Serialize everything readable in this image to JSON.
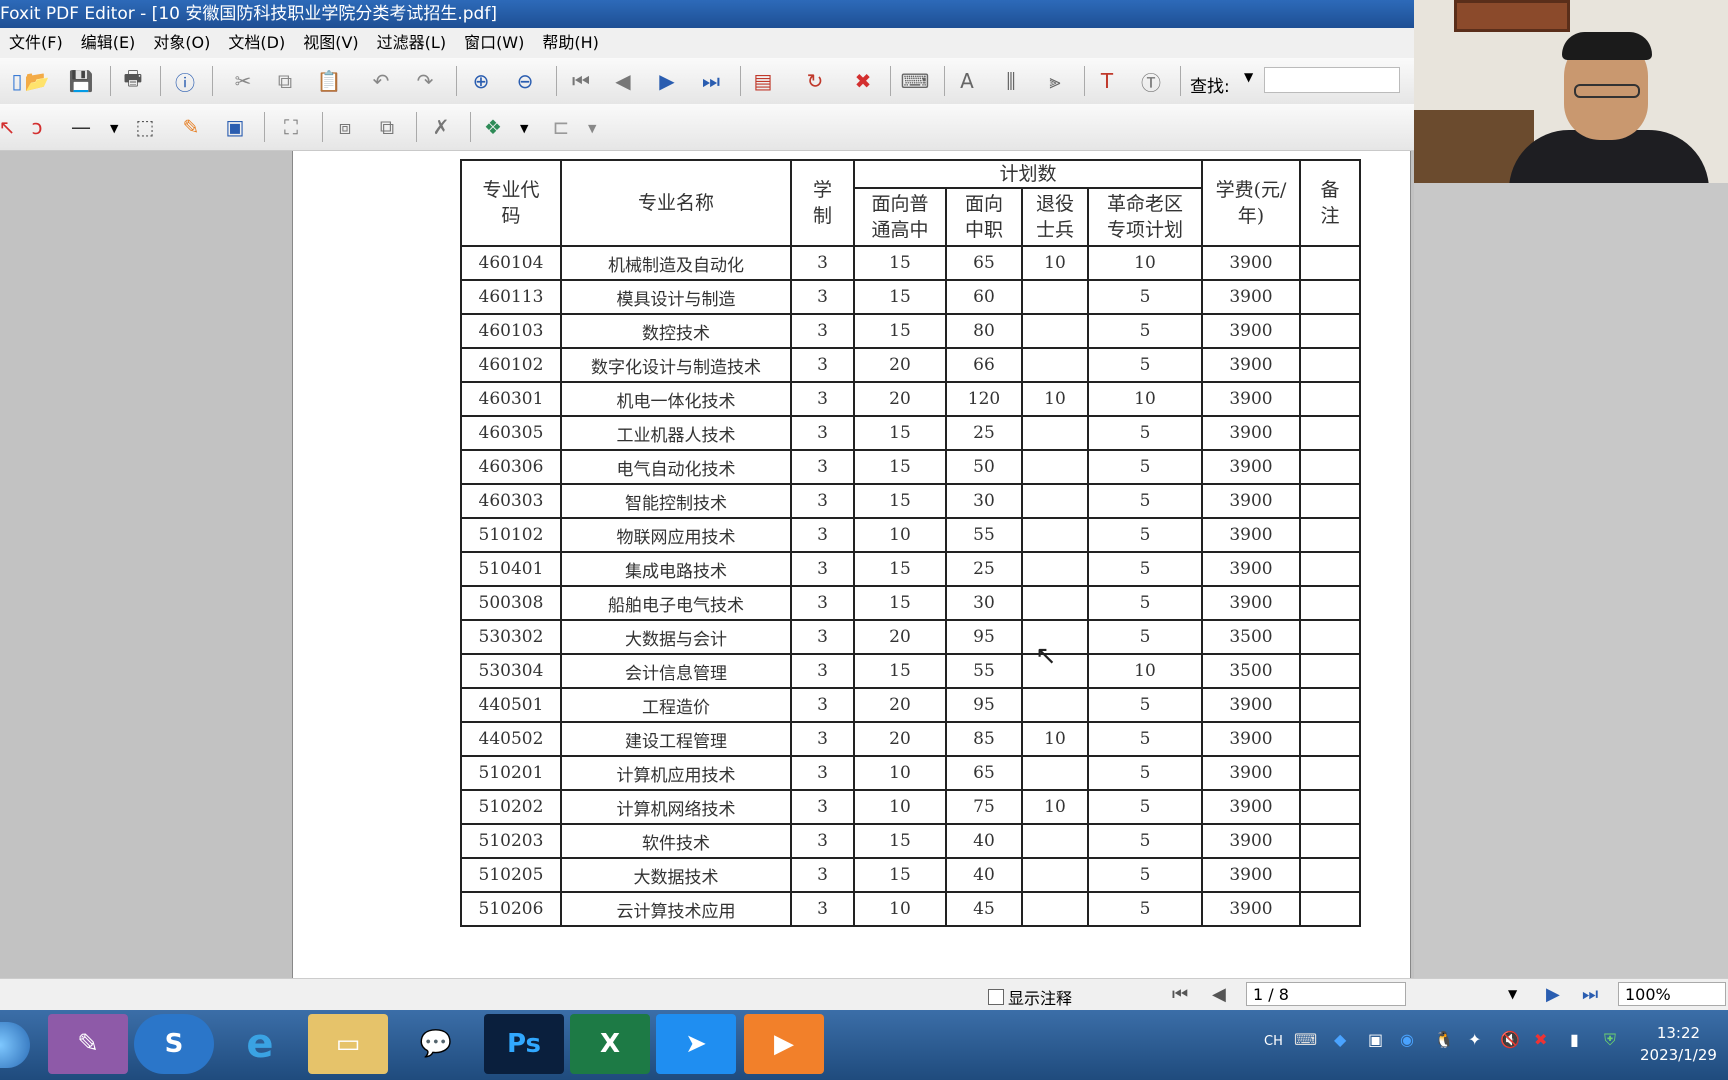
{
  "window": {
    "title": "Foxit PDF Editor - [10 安徽国防科技职业学院分类考试招生.pdf]"
  },
  "menu": [
    "文件(F)",
    "编辑(E)",
    "对象(O)",
    "文档(D)",
    "视图(V)",
    "过滤器(L)",
    "窗口(W)",
    "帮助(H)"
  ],
  "toolbar": {
    "search_label": "查找:",
    "search_value": ""
  },
  "table": {
    "header": {
      "code": "专业代码",
      "name": "专业名称",
      "years": "学制",
      "plan": "计划数",
      "plan_high": "面向普通高中",
      "plan_voc": "面向中职",
      "plan_vet": "退役士兵",
      "plan_old": "革命老区专项计划",
      "fee": "学费(元/年)",
      "note": "备注"
    },
    "rows": [
      [
        "460104",
        "机械制造及自动化",
        "3",
        "15",
        "65",
        "10",
        "10",
        "3900",
        ""
      ],
      [
        "460113",
        "模具设计与制造",
        "3",
        "15",
        "60",
        "",
        "5",
        "3900",
        ""
      ],
      [
        "460103",
        "数控技术",
        "3",
        "15",
        "80",
        "",
        "5",
        "3900",
        ""
      ],
      [
        "460102",
        "数字化设计与制造技术",
        "3",
        "20",
        "66",
        "",
        "5",
        "3900",
        ""
      ],
      [
        "460301",
        "机电一体化技术",
        "3",
        "20",
        "120",
        "10",
        "10",
        "3900",
        ""
      ],
      [
        "460305",
        "工业机器人技术",
        "3",
        "15",
        "25",
        "",
        "5",
        "3900",
        ""
      ],
      [
        "460306",
        "电气自动化技术",
        "3",
        "15",
        "50",
        "",
        "5",
        "3900",
        ""
      ],
      [
        "460303",
        "智能控制技术",
        "3",
        "15",
        "30",
        "",
        "5",
        "3900",
        ""
      ],
      [
        "510102",
        "物联网应用技术",
        "3",
        "10",
        "55",
        "",
        "5",
        "3900",
        ""
      ],
      [
        "510401",
        "集成电路技术",
        "3",
        "15",
        "25",
        "",
        "5",
        "3900",
        ""
      ],
      [
        "500308",
        "船舶电子电气技术",
        "3",
        "15",
        "30",
        "",
        "5",
        "3900",
        ""
      ],
      [
        "530302",
        "大数据与会计",
        "3",
        "20",
        "95",
        "",
        "5",
        "3500",
        ""
      ],
      [
        "530304",
        "会计信息管理",
        "3",
        "15",
        "55",
        "",
        "10",
        "3500",
        ""
      ],
      [
        "440501",
        "工程造价",
        "3",
        "20",
        "95",
        "",
        "5",
        "3900",
        ""
      ],
      [
        "440502",
        "建设工程管理",
        "3",
        "20",
        "85",
        "10",
        "5",
        "3900",
        ""
      ],
      [
        "510201",
        "计算机应用技术",
        "3",
        "10",
        "65",
        "",
        "5",
        "3900",
        ""
      ],
      [
        "510202",
        "计算机网络技术",
        "3",
        "10",
        "75",
        "10",
        "5",
        "3900",
        ""
      ],
      [
        "510203",
        "软件技术",
        "3",
        "15",
        "40",
        "",
        "5",
        "3900",
        ""
      ],
      [
        "510205",
        "大数据技术",
        "3",
        "15",
        "40",
        "",
        "5",
        "3900",
        ""
      ],
      [
        "510206",
        "云计算技术应用",
        "3",
        "10",
        "45",
        "",
        "5",
        "3900",
        ""
      ]
    ]
  },
  "statusbar": {
    "show_annotations": "显示注释",
    "page": "1 / 8",
    "zoom": "100%"
  },
  "taskbar": {
    "ime": "CH",
    "time": "13:22",
    "date": "2023/1/29",
    "ps_label": "Ps"
  },
  "colors": {
    "titlebar": "#2d6ab9",
    "taskbar": "#2b5a8f"
  }
}
